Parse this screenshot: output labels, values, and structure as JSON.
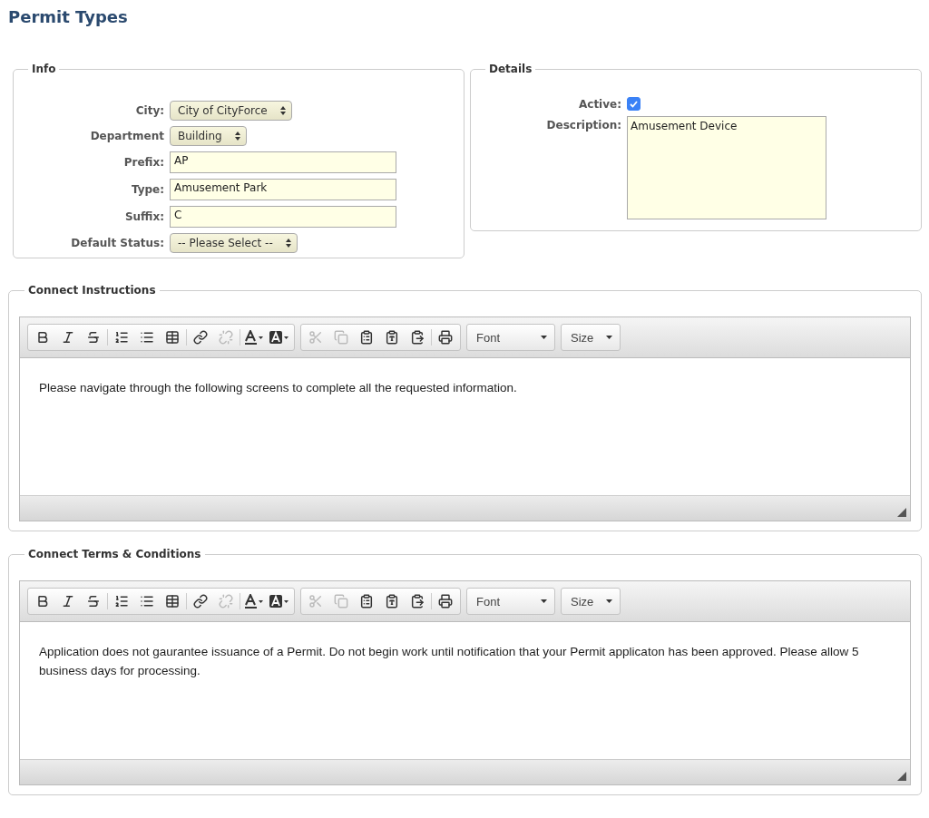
{
  "page_title": "Permit Types",
  "info": {
    "legend": "Info",
    "fields": [
      {
        "kind": "select",
        "label": "City:",
        "value": "City of CityForce"
      },
      {
        "kind": "select",
        "label": "Department",
        "value": "Building"
      },
      {
        "kind": "text",
        "label": "Prefix:",
        "value": "AP"
      },
      {
        "kind": "text",
        "label": "Type:",
        "value": "Amusement Park"
      },
      {
        "kind": "text",
        "label": "Suffix:",
        "value": "C"
      },
      {
        "kind": "select",
        "label": "Default Status:",
        "value": "-- Please Select --"
      }
    ]
  },
  "details": {
    "legend": "Details",
    "active_label": "Active:",
    "active_checked": true,
    "description_label": "Description:",
    "description": "Amusement Device"
  },
  "editors": [
    {
      "legend": "Connect Instructions",
      "toolbar": [
        {
          "kind": "bold",
          "disabled": false
        },
        {
          "kind": "italic",
          "disabled": false
        },
        {
          "kind": "strike",
          "disabled": false
        },
        {
          "kind": "sep"
        },
        {
          "kind": "numbered",
          "disabled": false
        },
        {
          "kind": "bulleted",
          "disabled": false
        },
        {
          "kind": "table",
          "disabled": false
        },
        {
          "kind": "sep"
        },
        {
          "kind": "link",
          "disabled": false
        },
        {
          "kind": "unlink",
          "disabled": true
        },
        {
          "kind": "sep"
        },
        {
          "kind": "textcolor",
          "disabled": false
        },
        {
          "kind": "bgcolor",
          "disabled": false
        },
        {
          "kind": "group"
        },
        {
          "kind": "cut",
          "disabled": true
        },
        {
          "kind": "copy",
          "disabled": true
        },
        {
          "kind": "paste",
          "disabled": false
        },
        {
          "kind": "pastetext",
          "disabled": false
        },
        {
          "kind": "pasteword",
          "disabled": false
        },
        {
          "kind": "sep"
        },
        {
          "kind": "print",
          "disabled": false
        }
      ],
      "font": "Font",
      "size": "Size",
      "content": "Please navigate through the following screens to complete all the requested information."
    },
    {
      "legend": "Connect Terms & Conditions",
      "toolbar": [
        {
          "kind": "bold",
          "disabled": false
        },
        {
          "kind": "italic",
          "disabled": false
        },
        {
          "kind": "strike",
          "disabled": false
        },
        {
          "kind": "sep"
        },
        {
          "kind": "numbered",
          "disabled": false
        },
        {
          "kind": "bulleted",
          "disabled": false
        },
        {
          "kind": "table",
          "disabled": false
        },
        {
          "kind": "sep"
        },
        {
          "kind": "link",
          "disabled": false
        },
        {
          "kind": "unlink",
          "disabled": true
        },
        {
          "kind": "sep"
        },
        {
          "kind": "textcolor",
          "disabled": false
        },
        {
          "kind": "bgcolor",
          "disabled": false
        },
        {
          "kind": "group"
        },
        {
          "kind": "cut",
          "disabled": true
        },
        {
          "kind": "copy",
          "disabled": true
        },
        {
          "kind": "paste",
          "disabled": false
        },
        {
          "kind": "pastetext",
          "disabled": false
        },
        {
          "kind": "pasteword",
          "disabled": false
        },
        {
          "kind": "sep"
        },
        {
          "kind": "print",
          "disabled": false
        }
      ],
      "font": "Font",
      "size": "Size",
      "content": "Application does not gaurantee issuance of a Permit. Do not begin work until notification that your Permit applicaton has been approved. Please allow 5 business days for processing."
    }
  ]
}
